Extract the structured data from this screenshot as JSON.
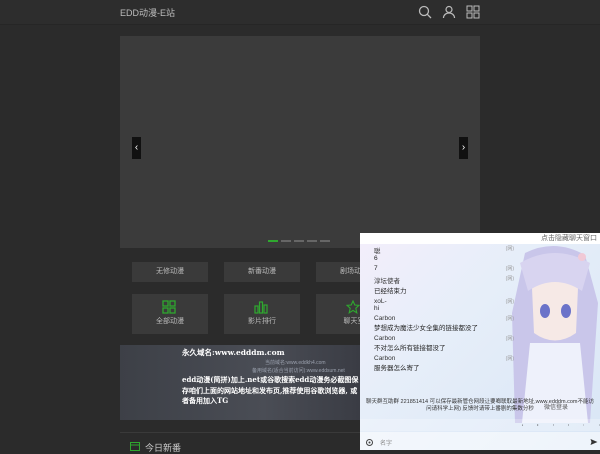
{
  "header": {
    "title": "EDD动漫-E站",
    "icons": [
      "search-icon",
      "user-icon",
      "grid-icon"
    ]
  },
  "banner": {
    "slides": 5,
    "active_slide": 1
  },
  "quick_links": [
    {
      "label": "无修动漫"
    },
    {
      "label": "新番动漫"
    },
    {
      "label": "剧场动漫"
    }
  ],
  "menu": [
    {
      "label": "全部动漫",
      "icon": "grid-icon"
    },
    {
      "label": "影片排行",
      "icon": "bar-chart-icon"
    },
    {
      "label": "聊天室",
      "icon": "star-icon"
    }
  ],
  "notice": {
    "domain": "永久域名:www.edddm.com",
    "watermark1": "当前域名:www.eddkh4.com",
    "watermark2": "备用域名(适合当前访问):www.eddsum.net",
    "body": "edd动漫(简拼)加上.net或谷歌搜索edd动漫务必截图保存咱们上面的网站地址和发布页,推荐使用谷歌浏览器, 或者备用加入TG"
  },
  "section": {
    "title": "今日新番"
  },
  "chat": {
    "header": "点击隐藏聊天窗口",
    "messages": [
      {
        "name": "聪",
        "text": "6",
        "tag": "(网)"
      },
      {
        "name": "",
        "text": "7",
        "tag": "(网)"
      },
      {
        "name": "淳坛使者",
        "text": "已经结束力",
        "tag": "(网)"
      },
      {
        "name": "xoL-",
        "text": "hi",
        "tag": "(网)"
      },
      {
        "name": "Carbon",
        "text": "梦想成为魔法少女全集的链接都没了",
        "tag": "(网)"
      },
      {
        "name": "Carbon",
        "text": "不对怎么所有链接都没了",
        "tag": "(网)"
      },
      {
        "name": "Carbon",
        "text": "服务器怎么寄了",
        "tag": "(网)"
      }
    ],
    "announcement": "聊天群互助群 221851414 可以保存最新管仓网段让要啷联取最新地址,www.edddm.com不能访问请科学上网) 反馈时请带上番剧的集数分秒",
    "verify_label": "微信登录",
    "input_placeholder": "名字"
  }
}
